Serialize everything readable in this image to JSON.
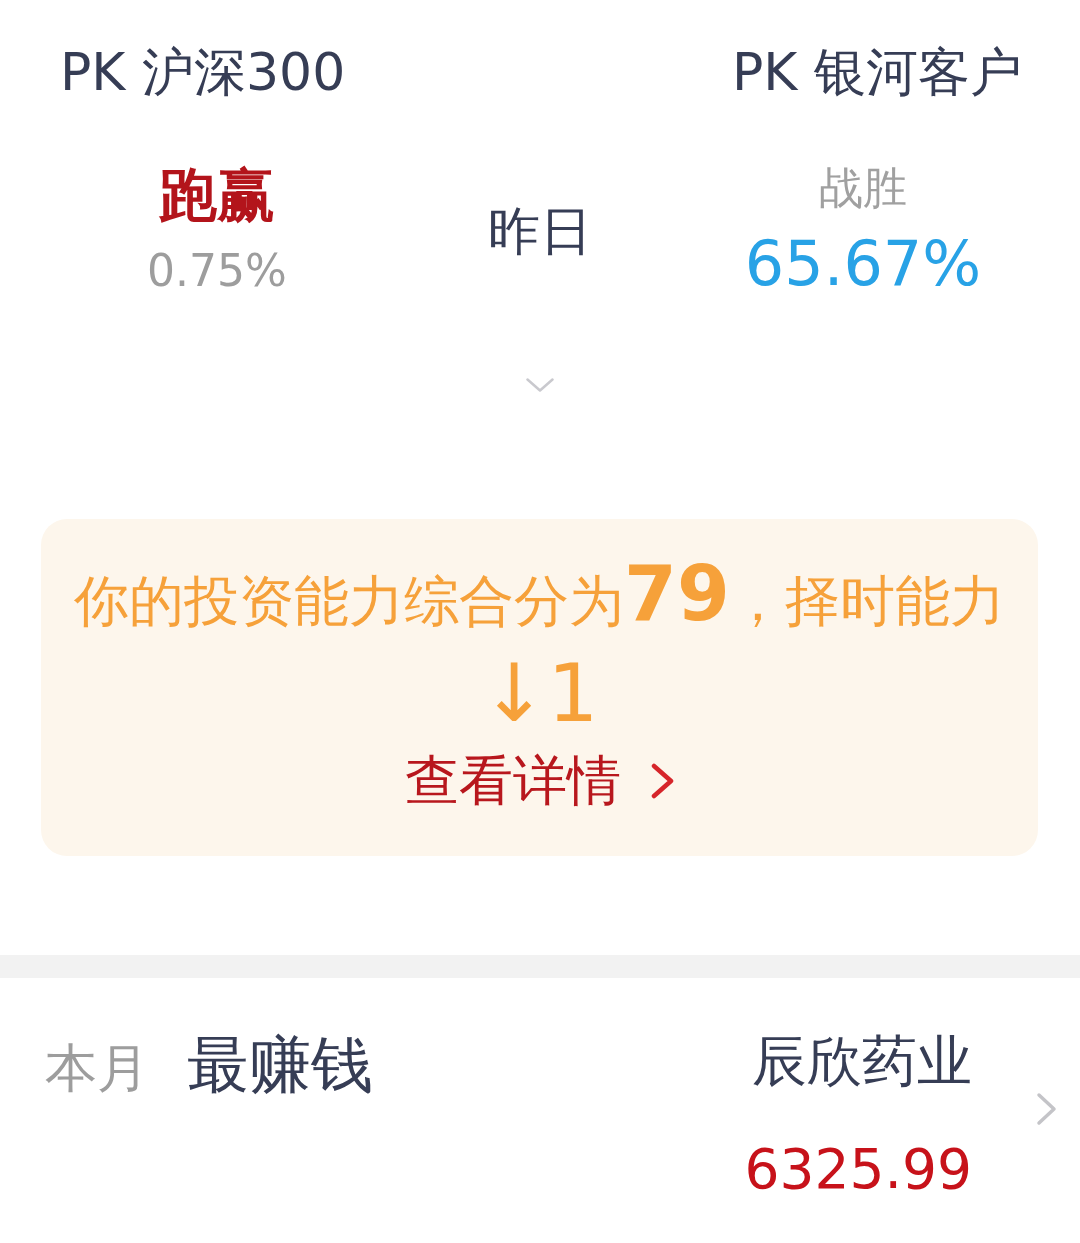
{
  "pk_header": {
    "left_title": "PK 沪深300",
    "right_title": "PK 银河客户"
  },
  "comparison": {
    "left": {
      "label": "跑赢",
      "value": "0.75%"
    },
    "center_label": "昨日",
    "right": {
      "label": "战胜",
      "value": "65.67%"
    }
  },
  "score_card": {
    "summary": "你的投资能力综合分为**79**，择时能力",
    "timing_change": "↓1",
    "link": "查看详情"
  },
  "monthly_top": {
    "period": "本月",
    "title": "最赚钱",
    "stock_name": "辰欣药业",
    "profit": "6325.99"
  }
}
